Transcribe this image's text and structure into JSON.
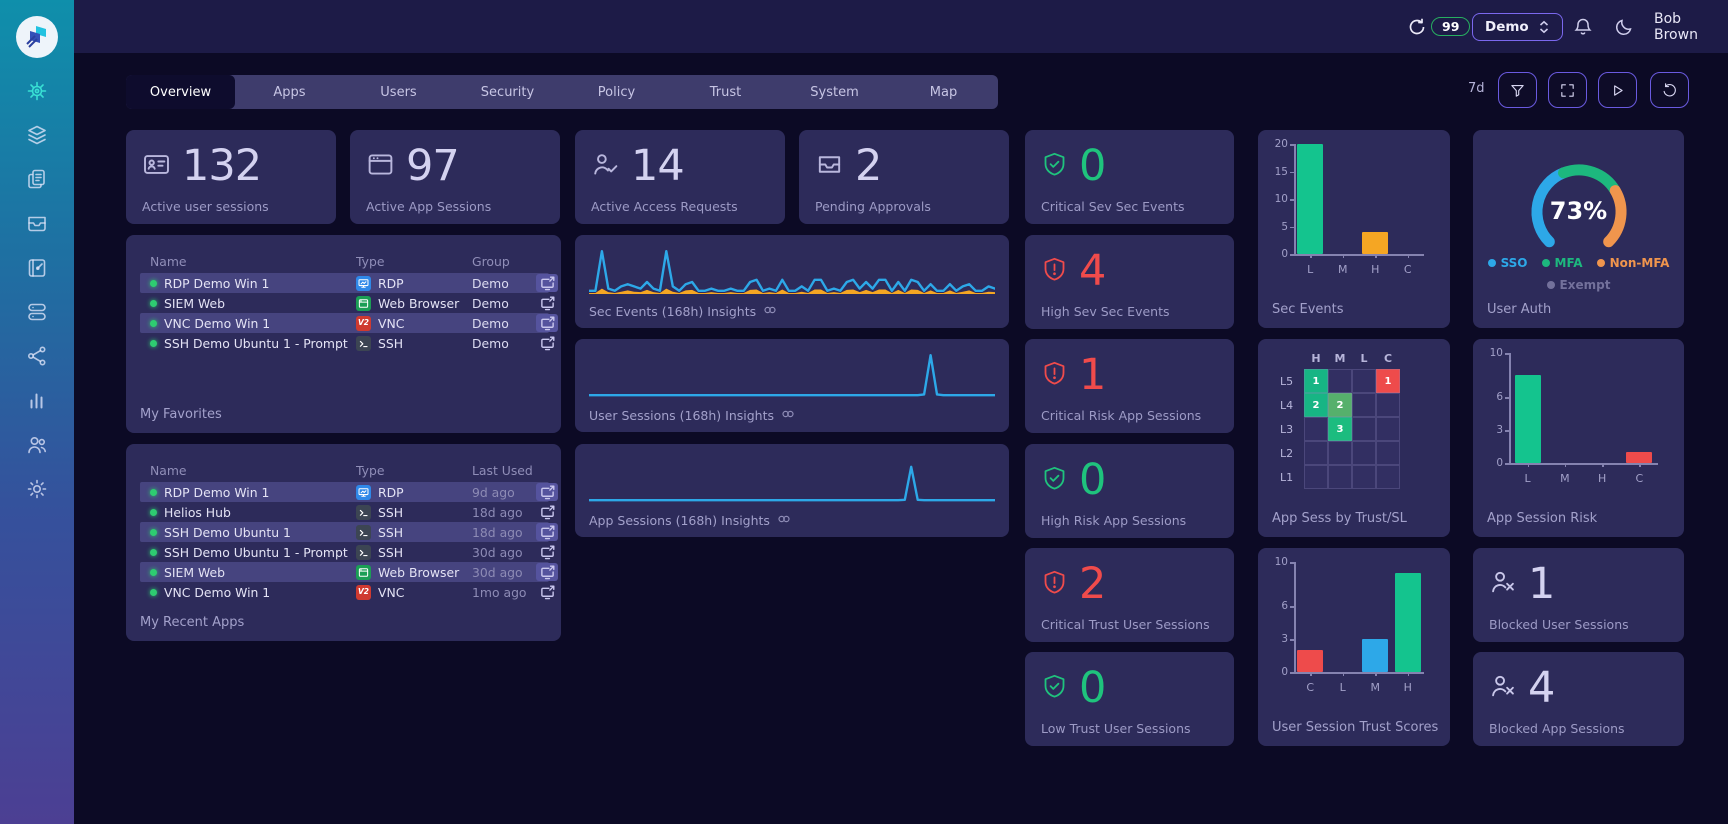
{
  "header": {
    "notif_count": "99",
    "tenant": "Demo",
    "user_name": "Bob Brown",
    "icons": [
      "sync-icon",
      "notification-badge",
      "bell-icon",
      "moon-icon",
      "user-circle-icon"
    ]
  },
  "sidebar": {
    "items": [
      "dashboard",
      "layers",
      "documents",
      "inbox",
      "policy-book",
      "servers",
      "share",
      "metrics",
      "users",
      "settings"
    ]
  },
  "tabs": [
    {
      "label": "Overview",
      "active": true
    },
    {
      "label": "Apps",
      "active": false
    },
    {
      "label": "Users",
      "active": false
    },
    {
      "label": "Security",
      "active": false
    },
    {
      "label": "Policy",
      "active": false
    },
    {
      "label": "Trust",
      "active": false
    },
    {
      "label": "System",
      "active": false
    },
    {
      "label": "Map",
      "active": false
    }
  ],
  "toolbar": {
    "range": "7d",
    "buttons": [
      "filter",
      "fullscreen",
      "play",
      "refresh"
    ]
  },
  "stats": [
    {
      "value": "132",
      "label": "Active user sessions",
      "icon": "id-card"
    },
    {
      "value": "97",
      "label": "Active App Sessions",
      "icon": "app-window"
    },
    {
      "value": "14",
      "label": "Active Access Requests",
      "icon": "user-check"
    },
    {
      "value": "2",
      "label": "Pending Approvals",
      "icon": "inbox-tray"
    }
  ],
  "kpis": [
    {
      "value": "0",
      "label": "Critical Sev Sec Events",
      "status": "ok"
    },
    {
      "value": "4",
      "label": "High Sev Sec Events",
      "status": "alert"
    },
    {
      "value": "1",
      "label": "Critical Risk App Sessions",
      "status": "alert"
    },
    {
      "value": "0",
      "label": "High Risk App Sessions",
      "status": "ok"
    },
    {
      "value": "2",
      "label": "Critical Trust User Sessions",
      "status": "alert"
    },
    {
      "value": "0",
      "label": "Low Trust User Sessions",
      "status": "ok"
    }
  ],
  "blocked": [
    {
      "value": "1",
      "label": "Blocked User Sessions",
      "icon": "user-x"
    },
    {
      "value": "4",
      "label": "Blocked App Sessions",
      "icon": "user-x"
    }
  ],
  "favorites": {
    "title": "My Favorites",
    "columns": [
      "Name",
      "Type",
      "Group"
    ],
    "rows": [
      {
        "name": "RDP Demo Win 1",
        "type": "RDP",
        "third": "Demo"
      },
      {
        "name": "SIEM Web",
        "type": "Web Browser",
        "third": "Demo"
      },
      {
        "name": "VNC Demo Win 1",
        "type": "VNC",
        "third": "Demo"
      },
      {
        "name": "SSH Demo Ubuntu 1 - Prompt",
        "type": "SSH",
        "third": "Demo"
      }
    ]
  },
  "recent": {
    "title": "My Recent Apps",
    "columns": [
      "Name",
      "Type",
      "Last Used"
    ],
    "rows": [
      {
        "name": "RDP Demo Win 1",
        "type": "RDP",
        "third": "9d ago"
      },
      {
        "name": "Helios Hub",
        "type": "SSH",
        "third": "18d ago"
      },
      {
        "name": "SSH Demo Ubuntu 1",
        "type": "SSH",
        "third": "18d ago"
      },
      {
        "name": "SSH Demo Ubuntu 1 - Prompt",
        "type": "SSH",
        "third": "30d ago"
      },
      {
        "name": "SIEM Web",
        "type": "Web Browser",
        "third": "30d ago"
      },
      {
        "name": "VNC Demo Win 1",
        "type": "VNC",
        "third": "1mo ago"
      }
    ]
  },
  "colors": {
    "green": "#1fc37d",
    "red": "#f04b4b",
    "orange": "#f5a623",
    "blue": "#2da8e8",
    "teal_bar": "#14c48e",
    "card_bg": "#2d2b5a",
    "page_bg": "#0c0a25",
    "accent_purple": "#7b68ee"
  },
  "chart_data": [
    {
      "id": "sec_events",
      "type": "bar",
      "title": "Sec Events",
      "categories": [
        "L",
        "M",
        "H",
        "C"
      ],
      "values": [
        20,
        0,
        4,
        0
      ],
      "bar_colors": [
        "#14c48e",
        "#14c48e",
        "#f5a623",
        "#14c48e"
      ],
      "yticks": [
        0,
        5,
        10,
        15,
        20
      ],
      "ylim": [
        0,
        20
      ]
    },
    {
      "id": "user_auth",
      "type": "donut",
      "title": "User Auth",
      "center_label": "73%",
      "segments": [
        {
          "name": "SSO",
          "value": 42,
          "color": "#2da8e8"
        },
        {
          "name": "MFA",
          "value": 30,
          "color": "#1db87e"
        },
        {
          "name": "Non-MFA",
          "value": 28,
          "color": "#f0954d"
        }
      ],
      "legend2": [
        {
          "name": "Exempt",
          "color": "#73719b"
        }
      ]
    },
    {
      "id": "heatmap",
      "type": "heatmap",
      "title": "App Sess by Trust/SL",
      "columns": [
        "H",
        "M",
        "L",
        "C"
      ],
      "rows": [
        "L5",
        "L4",
        "L3",
        "L2",
        "L1"
      ],
      "cells": [
        {
          "r": 0,
          "c": 0,
          "v": 1,
          "color": "#17b584"
        },
        {
          "r": 0,
          "c": 3,
          "v": 1,
          "color": "#ee4b4b"
        },
        {
          "r": 1,
          "c": 0,
          "v": 2,
          "color": "#17b584"
        },
        {
          "r": 1,
          "c": 1,
          "v": 2,
          "color": "#56b06c"
        },
        {
          "r": 2,
          "c": 1,
          "v": 3,
          "color": "#1cbc7f"
        }
      ]
    },
    {
      "id": "app_risk",
      "type": "bar",
      "title": "App Session Risk",
      "categories": [
        "L",
        "M",
        "H",
        "C"
      ],
      "values": [
        8,
        0,
        0,
        1
      ],
      "bar_colors": [
        "#14c48e",
        "#14c48e",
        "#14c48e",
        "#ee4b4b"
      ],
      "yticks": [
        0,
        3,
        6,
        10
      ],
      "ylim": [
        0,
        10
      ]
    },
    {
      "id": "trust_scores",
      "type": "bar",
      "title": "User Session Trust Scores",
      "categories": [
        "C",
        "L",
        "M",
        "H"
      ],
      "values": [
        2,
        0,
        3,
        9
      ],
      "bar_colors": [
        "#ee4b4b",
        "#14c48e",
        "#2da8e8",
        "#14c48e"
      ],
      "yticks": [
        0,
        3,
        6,
        10
      ],
      "ylim": [
        0,
        10
      ]
    },
    {
      "id": "spark_sec",
      "type": "area",
      "title": "Sec Events (168h) Insights",
      "ylim": [
        0,
        10
      ],
      "series": [
        {
          "name": "sec-events",
          "color": "#2da8e8",
          "values": [
            0.5,
            0.5,
            9.5,
            1,
            0.5,
            1.5,
            2,
            1.5,
            1,
            2.5,
            1,
            0.5,
            9.5,
            1.5,
            0.5,
            2,
            2.5,
            0.5,
            0.5,
            1,
            0.5,
            0.5,
            1,
            0.5,
            0.5,
            2.5,
            3,
            0.5,
            1,
            0.5,
            3,
            0.5,
            0.5,
            1.5,
            0.5,
            3,
            3,
            0.5,
            1,
            0.5,
            2.5,
            3,
            1,
            2.5,
            1,
            3,
            3,
            0.5,
            2.5,
            0.5,
            3,
            2.5,
            0.5,
            2,
            0.5,
            0.5,
            2,
            0.5,
            1.5,
            2,
            0.5,
            0.5,
            1.5,
            1
          ]
        },
        {
          "name": "high-sev-events",
          "color": "#f5a623",
          "values": [
            0,
            0,
            1,
            0.2,
            0,
            0.3,
            0.6,
            0.3,
            0.2,
            0.7,
            0.2,
            0,
            1,
            0.3,
            0,
            0.6,
            0.7,
            0,
            0,
            0.2,
            0,
            0,
            0.2,
            0,
            0,
            0.7,
            0.8,
            0,
            0.2,
            0,
            0.8,
            0,
            0,
            0.3,
            0,
            0.8,
            0.8,
            0,
            0.2,
            0,
            0.7,
            0.8,
            0.2,
            0.7,
            0.2,
            0.8,
            0.8,
            0,
            0.7,
            0,
            0.8,
            0.7,
            0,
            0.6,
            0,
            0,
            0.6,
            0,
            0.3,
            0.6,
            0,
            0,
            0.3,
            0.2
          ]
        }
      ]
    },
    {
      "id": "spark_user",
      "type": "line",
      "title": "User Sessions (168h) Insights",
      "ylim": [
        0,
        10
      ],
      "series": [
        {
          "name": "user-sessions",
          "color": "#2da8e8",
          "values": [
            0.4,
            0.4,
            0.4,
            0.4,
            0.4,
            0.4,
            0.4,
            0.4,
            0.4,
            0.4,
            0.4,
            0.4,
            0.4,
            0.4,
            0.4,
            0.4,
            0.4,
            0.4,
            0.4,
            0.4,
            0.4,
            0.4,
            0.4,
            0.4,
            0.4,
            0.4,
            0.4,
            0.4,
            0.4,
            0.4,
            0.4,
            0.4,
            0.4,
            0.4,
            0.4,
            0.4,
            0.4,
            0.4,
            0.4,
            0.4,
            0.4,
            0.4,
            0.4,
            0.4,
            0.4,
            0.4,
            0.4,
            0.4,
            0.4,
            0.4,
            0.4,
            0.4,
            0.6,
            9.5,
            0.6,
            0.4,
            0.4,
            0.4,
            0.4,
            0.4,
            0.4,
            0.4,
            0.4,
            0.4
          ]
        }
      ]
    },
    {
      "id": "spark_app",
      "type": "line",
      "title": "App Sessions (168h) Insights",
      "ylim": [
        0,
        10
      ],
      "series": [
        {
          "name": "app-sessions",
          "color": "#2da8e8",
          "values": [
            0.4,
            0.4,
            0.4,
            0.4,
            0.4,
            0.4,
            0.4,
            0.4,
            0.4,
            0.4,
            0.4,
            0.4,
            0.4,
            0.4,
            0.4,
            0.4,
            0.4,
            0.4,
            0.4,
            0.4,
            0.4,
            0.4,
            0.4,
            0.4,
            0.4,
            0.4,
            0.4,
            0.4,
            0.4,
            0.4,
            0.4,
            0.4,
            0.4,
            0.4,
            0.4,
            0.4,
            0.4,
            0.4,
            0.4,
            0.4,
            0.4,
            0.4,
            0.4,
            0.4,
            0.4,
            0.4,
            0.4,
            0.4,
            0.4,
            0.5,
            8,
            0.5,
            0.4,
            0.4,
            0.4,
            0.4,
            0.4,
            0.4,
            0.4,
            0.4,
            0.4,
            0.4,
            0.4,
            0.4
          ]
        }
      ]
    }
  ]
}
